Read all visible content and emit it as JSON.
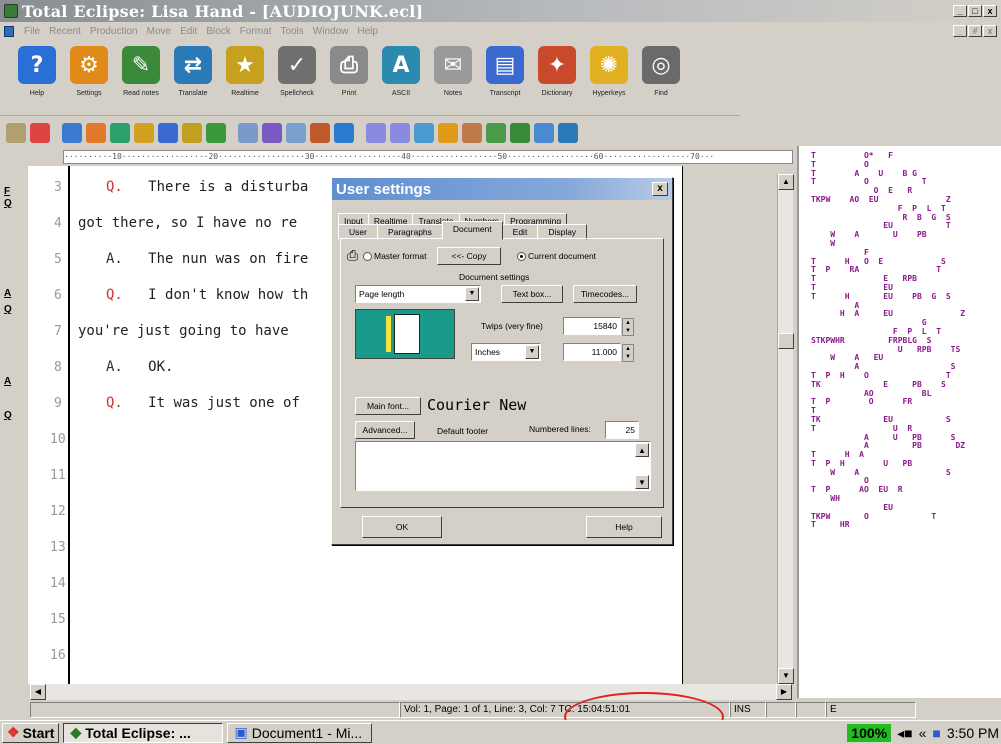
{
  "window": {
    "title": "Total Eclipse: Lisa Hand - [AUDIOJUNK.ecl]",
    "controls": [
      "_",
      "□",
      "x"
    ],
    "doc_controls": [
      "_",
      "#",
      "x"
    ]
  },
  "menu": [
    "File",
    "Recent",
    "Production",
    "Move",
    "Edit",
    "Block",
    "Format",
    "Tools",
    "Window",
    "Help"
  ],
  "toolbar": [
    {
      "label": "Help",
      "icon": "help-icon",
      "color": "#2a6fd6"
    },
    {
      "label": "Settings",
      "icon": "settings-gear-icon",
      "color": "#e08a1a"
    },
    {
      "label": "Read notes",
      "icon": "read-notes-icon",
      "color": "#3a8a3a"
    },
    {
      "label": "Translate",
      "icon": "translate-icon",
      "color": "#2a7ab8"
    },
    {
      "label": "Realtime",
      "icon": "realtime-icon",
      "color": "#c8a020"
    },
    {
      "label": "Spellcheck",
      "icon": "spellcheck-icon",
      "color": "#707070"
    },
    {
      "label": "Print",
      "icon": "printer-icon",
      "color": "#8a8a8a"
    },
    {
      "label": "ASCII",
      "icon": "ascii-icon",
      "color": "#2a8ab0"
    },
    {
      "label": "Notes",
      "icon": "notes-icon",
      "color": "#9a9a9a"
    },
    {
      "label": "Transcript",
      "icon": "transcript-icon",
      "color": "#3a6ad0"
    },
    {
      "label": "Dictionary",
      "icon": "dictionary-icon",
      "color": "#c84a2a"
    },
    {
      "label": "Hyperkeys",
      "icon": "hyperkeys-icon",
      "color": "#e0b020"
    },
    {
      "label": "Find",
      "icon": "find-binoculars-icon",
      "color": "#6a6a6a"
    }
  ],
  "toolbar2_colors": [
    "#b0a070",
    "#d44",
    "#3a7ad0",
    "#e07a2a",
    "#2aa06a",
    "#d0a020",
    "#3a6ad0",
    "#c0a020",
    "#3a9a3a",
    "#7a9aca",
    "#7a5ac0",
    "#7aa0d0",
    "#c05a2a",
    "#2a7ad0",
    "#8a8ae0",
    "#8a8ae0",
    "#4a9ad0",
    "#e09a1a",
    "#c07a4a",
    "#4a9a4a",
    "#3a8a3a",
    "#4a8ad0",
    "#2a7ab8"
  ],
  "ruler_text": "··········10··················20··················30··················40··················50··················60··················70···",
  "gutter_marks": [
    "F",
    "Q",
    "A",
    "Q",
    "A",
    "Q"
  ],
  "transcript": [
    {
      "num": "3",
      "prefix": "Q.",
      "text": "There is a disturba"
    },
    {
      "num": "4",
      "prefix": "",
      "text": "got there, so I have no re"
    },
    {
      "num": "5",
      "prefix": "A.",
      "text": "The nun was on fire"
    },
    {
      "num": "6",
      "prefix": "Q.",
      "text": "I don't know how th"
    },
    {
      "num": "7",
      "prefix": "",
      "text": "you're just going to have"
    },
    {
      "num": "8",
      "prefix": "A.",
      "text": "OK."
    },
    {
      "num": "9",
      "prefix": "Q.",
      "text": "It was just one of"
    },
    {
      "num": "10",
      "prefix": "",
      "text": ""
    },
    {
      "num": "11",
      "prefix": "",
      "text": ""
    },
    {
      "num": "12",
      "prefix": "",
      "text": ""
    },
    {
      "num": "13",
      "prefix": "",
      "text": ""
    },
    {
      "num": "14",
      "prefix": "",
      "text": ""
    },
    {
      "num": "15",
      "prefix": "",
      "text": ""
    },
    {
      "num": "16",
      "prefix": "",
      "text": ""
    }
  ],
  "steno_text": "T          O*   F\nT          O\nT        A    U    B G\nT          O           T\n             O  E   R\nTKPW    AO  EU              Z\n                  F  P  L  T\n                   R  B  G  S\n               EU           T\n    W    A       U    PB\n    W\n           F\nT      H   O  E            S\nT  P    RA                T\nT              E   RPB\nT              EU\nT      H       EU    PB  G  S\n         A\n      H  A     EU              Z\n                       G\n                 F  P  L  T\nSTKPWHR         FRPBLG  S\n                  U   RPB    TS\n    W    A   EU\n         A                   S\nT  P  H    O                T\nTK             E     PB    S\n           AO          BL\nT  P        O      FR\nT\nTK             EU           S\nT                U  R\n           A     U   PB      S\n           A         PB       DZ\nT      H  A\nT  P  H        U   PB\n    W    A                  S\n           O\nT  P      AO  EU  R\n    WH\n               EU\nTKPW       O             T\nT     HR",
  "dialog": {
    "title": "User settings",
    "close": "x",
    "tabs_row1": [
      "Input",
      "Realtime",
      "Translate",
      "Numbers",
      "Programming"
    ],
    "tabs_row2": [
      "User",
      "Paragraphs",
      "Document",
      "Edit",
      "Display"
    ],
    "selected_tab": "Document",
    "master_format_label": "Master format",
    "copy_button": "<<- Copy",
    "current_document_label": "Current document",
    "document_settings_label": "Document settings",
    "setting_select": "Page length",
    "text_box_button": "Text box...",
    "timecodes_button": "Timecodes...",
    "twips_label": "Twips (very fine)",
    "twips_value": "15840",
    "units_select": "Inches",
    "inches_value": "11.000",
    "main_font_button": "Main font...",
    "font_name": "Courier New",
    "advanced_button": "Advanced...",
    "default_footer_label": "Default footer",
    "numbered_lines_label": "Numbered lines:",
    "numbered_lines_value": "25",
    "ok_button": "OK",
    "help_button": "Help"
  },
  "status": {
    "position": "Vol: 1, Page: 1 of 1, Line: 3, Col: 7 TC: 15:04:51:01",
    "mode": "INS",
    "e": "E"
  },
  "taskbar": {
    "start": "Start",
    "task1": "Total Eclipse: ...",
    "task2": "Document1 - Mi...",
    "zoom": "100%",
    "time": "3:50 PM"
  }
}
